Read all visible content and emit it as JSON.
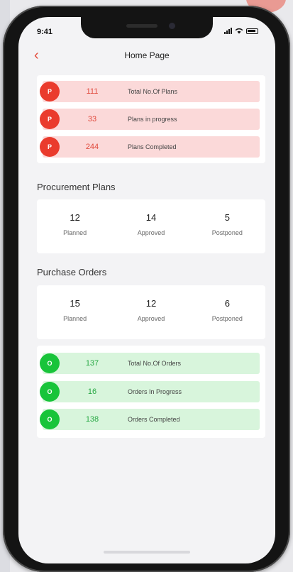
{
  "status_bar": {
    "time": "9:41"
  },
  "header": {
    "title": "Home Page",
    "back_glyph": "‹"
  },
  "plans_summary": [
    {
      "icon": "P",
      "value": "111",
      "label": "Total No.Of Plans",
      "icon_name": "plans-total-icon"
    },
    {
      "icon": "P",
      "value": "33",
      "label": "Plans in progress",
      "icon_name": "plans-progress-icon"
    },
    {
      "icon": "P",
      "value": "244",
      "label": "Plans Completed",
      "icon_name": "plans-completed-icon"
    }
  ],
  "procurement": {
    "title": "Procurement Plans",
    "stats": [
      {
        "value": "12",
        "label": "Planned"
      },
      {
        "value": "14",
        "label": "Approved"
      },
      {
        "value": "5",
        "label": "Postponed"
      }
    ]
  },
  "purchase": {
    "title": "Purchase Orders",
    "stats": [
      {
        "value": "15",
        "label": "Planned"
      },
      {
        "value": "12",
        "label": "Approved"
      },
      {
        "value": "6",
        "label": "Postponed"
      }
    ]
  },
  "orders_summary": [
    {
      "icon": "O",
      "value": "137",
      "label": "Total No.Of Orders",
      "icon_name": "orders-total-icon"
    },
    {
      "icon": "O",
      "value": "16",
      "label": "Orders In Progress",
      "icon_name": "orders-progress-icon"
    },
    {
      "icon": "O",
      "value": "138",
      "label": "Orders Completed",
      "icon_name": "orders-completed-icon"
    }
  ],
  "colors": {
    "red": "#ea3b2d",
    "green": "#18c43a",
    "red_bg": "#fbd9d9",
    "green_bg": "#d8f5dc"
  }
}
